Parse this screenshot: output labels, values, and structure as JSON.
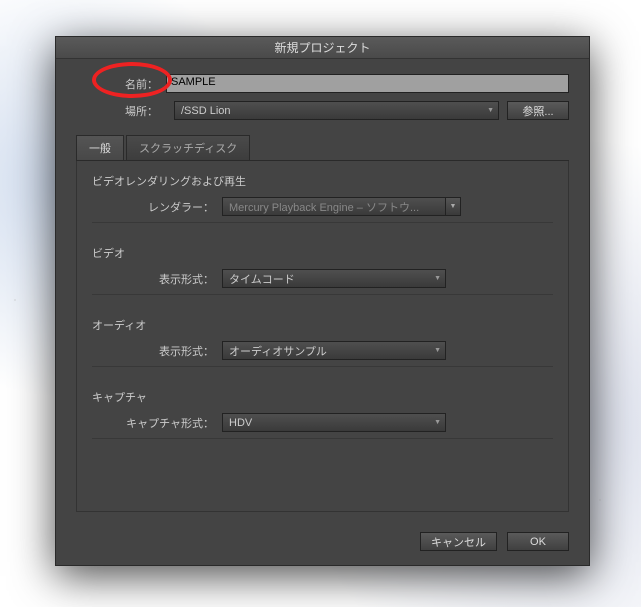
{
  "dialog": {
    "title": "新規プロジェクト",
    "name_label": "名前：",
    "name_value": "SAMPLE",
    "location_label": "場所：",
    "location_value": "/SSD Lion",
    "browse_button": "参照..."
  },
  "tabs": [
    {
      "label": "一般"
    },
    {
      "label": "スクラッチディスク"
    }
  ],
  "groups": {
    "rendering": {
      "title": "ビデオレンダリングおよび再生",
      "renderer_label": "レンダラー：",
      "renderer_value": "Mercury Playback Engine – ソフトウ..."
    },
    "video": {
      "title": "ビデオ",
      "format_label": "表示形式：",
      "format_value": "タイムコード"
    },
    "audio": {
      "title": "オーディオ",
      "format_label": "表示形式：",
      "format_value": "オーディオサンプル"
    },
    "capture": {
      "title": "キャプチャ",
      "format_label": "キャプチャ形式：",
      "format_value": "HDV"
    }
  },
  "footer": {
    "cancel": "キャンセル",
    "ok": "OK"
  }
}
